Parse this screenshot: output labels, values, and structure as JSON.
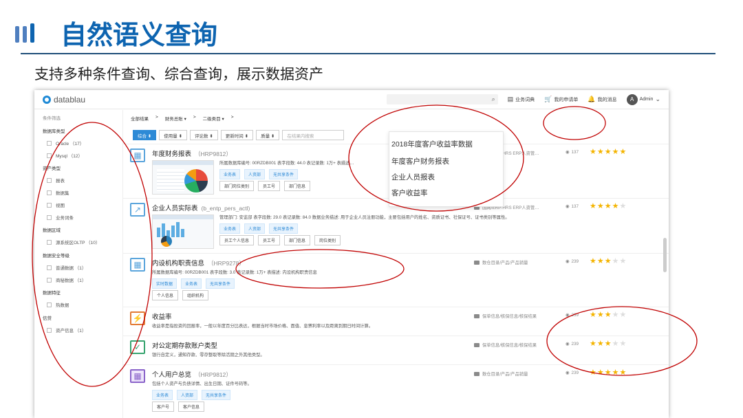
{
  "slide": {
    "title": "自然语义查询",
    "subtitle": "支持多种条件查询、综合查询，展示数据资产"
  },
  "app": {
    "logo_text": "datablau",
    "topbar": {
      "search_icon": "⌕",
      "items": [
        {
          "icon": "▤",
          "label": "业务词典"
        },
        {
          "icon": "🛒",
          "label": "我的申请单"
        },
        {
          "icon": "🔔",
          "label": "我的消息"
        }
      ],
      "avatar_letter": "A",
      "user": "Admin",
      "chevron": "⌄"
    },
    "sidebar": {
      "header": "条件筛选",
      "groups": [
        {
          "title": "数据库类型",
          "options": [
            "Oracle （17）",
            "Mysql （12）"
          ]
        },
        {
          "title": "资产类型",
          "options": [
            "报表",
            "数据集",
            "视图",
            "业务词条"
          ]
        },
        {
          "title": "数据区域",
          "options": [
            "源系统区OLTP （10）"
          ]
        },
        {
          "title": "数据安全等级",
          "options": [
            "普通数据 （1）",
            "商秘数据 （1）"
          ]
        },
        {
          "title": "数据特征",
          "options": [
            "热数据"
          ]
        },
        {
          "title": "信贷",
          "options": [
            "资产信息 （1）"
          ]
        }
      ]
    },
    "breadcrumb": [
      "全部结果",
      ">",
      "财务总账 ▾",
      ">",
      "二级类目 ▾",
      ">"
    ],
    "filters": [
      "综合 ⬍",
      "使用量 ⬍",
      "评论数 ⬍",
      "更新时间 ⬍",
      "质量 ⬍"
    ],
    "filter_input_placeholder": "在结果内搜索",
    "dropdown": [
      "2018年度客户收益率数据",
      "年度客户财务报表",
      "企业人员报表",
      "客户收益率"
    ],
    "items": [
      {
        "title": "年度财务报表",
        "code": "（HRP9812）",
        "desc": "所属数据库编号: 00RZDB001  表字段数: 44.0  表记录数: 1万+  表描述…",
        "tags": [
          "业务表",
          "人资部",
          "无共享条件"
        ],
        "labels": [
          "部门岗位类别",
          "员工号",
          "部门信息"
        ],
        "path": "国网/ERP-HRS ERP人资管…",
        "views": "137",
        "rating": 5
      },
      {
        "title": "企业人员实际表",
        "code": "(b_entp_pers_actl)",
        "desc": "管理部门: 安监部  表字段数: 29.0  表记录数: 84.0  数据业务描述: 用于企业人员注册功能，主要包括用户的姓名、资质证书、社保证号、证书类别等属性。",
        "tags": [
          "业务表",
          "人资部",
          "无共享条件"
        ],
        "labels": [
          "员工个人信息",
          "员工号",
          "部门信息",
          "岗位类别"
        ],
        "path": "国网/ERP-HRS ERP人资管…",
        "views": "137",
        "rating": 4
      },
      {
        "title": "内设机构职责信息",
        "code": "（HRP9278）",
        "desc": "所属数据库编号: 00RZDB001  表字段数: 3.0  表记录数: 1万+  表描述: 内设机构职责信息",
        "tags": [
          "实时数据",
          "业务表",
          "无共享条件"
        ],
        "labels": [
          "个人信息",
          "组织机构"
        ],
        "path": "数仓目录/产品/产品销量",
        "views": "239",
        "rating": 3
      },
      {
        "title": "收益率",
        "desc": "收益率是指投资的回报率，一般以年度百分比表达，根据当时市场价格、面值、息票利率以及距离到期日时间计算。",
        "path": "保单信息/核保信息/核保结果",
        "views": "239",
        "rating": 3
      },
      {
        "title": "对公定期存款账户类型",
        "desc": "银行自定义，通知存款、零存整取等除活期之外其他类型。",
        "path": "保单信息/核保信息/核保结果",
        "views": "239",
        "rating": 3
      },
      {
        "title": "个人用户总览",
        "code": "（HRP9812）",
        "desc": "包括个人资产与负债详情、出生日期、证件号码等。",
        "tags": [
          "业务表",
          "人资部",
          "无共享条件"
        ],
        "labels": [
          "客户号",
          "客户信息"
        ],
        "path": "数仓目录/产品/产品销量",
        "views": "239",
        "rating": 5
      }
    ],
    "eye_icon": "◉",
    "item_icons": [
      "▦",
      "↗",
      "▦",
      "⚡",
      "✓",
      "▦"
    ]
  },
  "colors": {
    "title_blue": "#0d64b0",
    "accent": "#2d8ad6",
    "star": "#f4b400",
    "annotation": "#c00000"
  }
}
